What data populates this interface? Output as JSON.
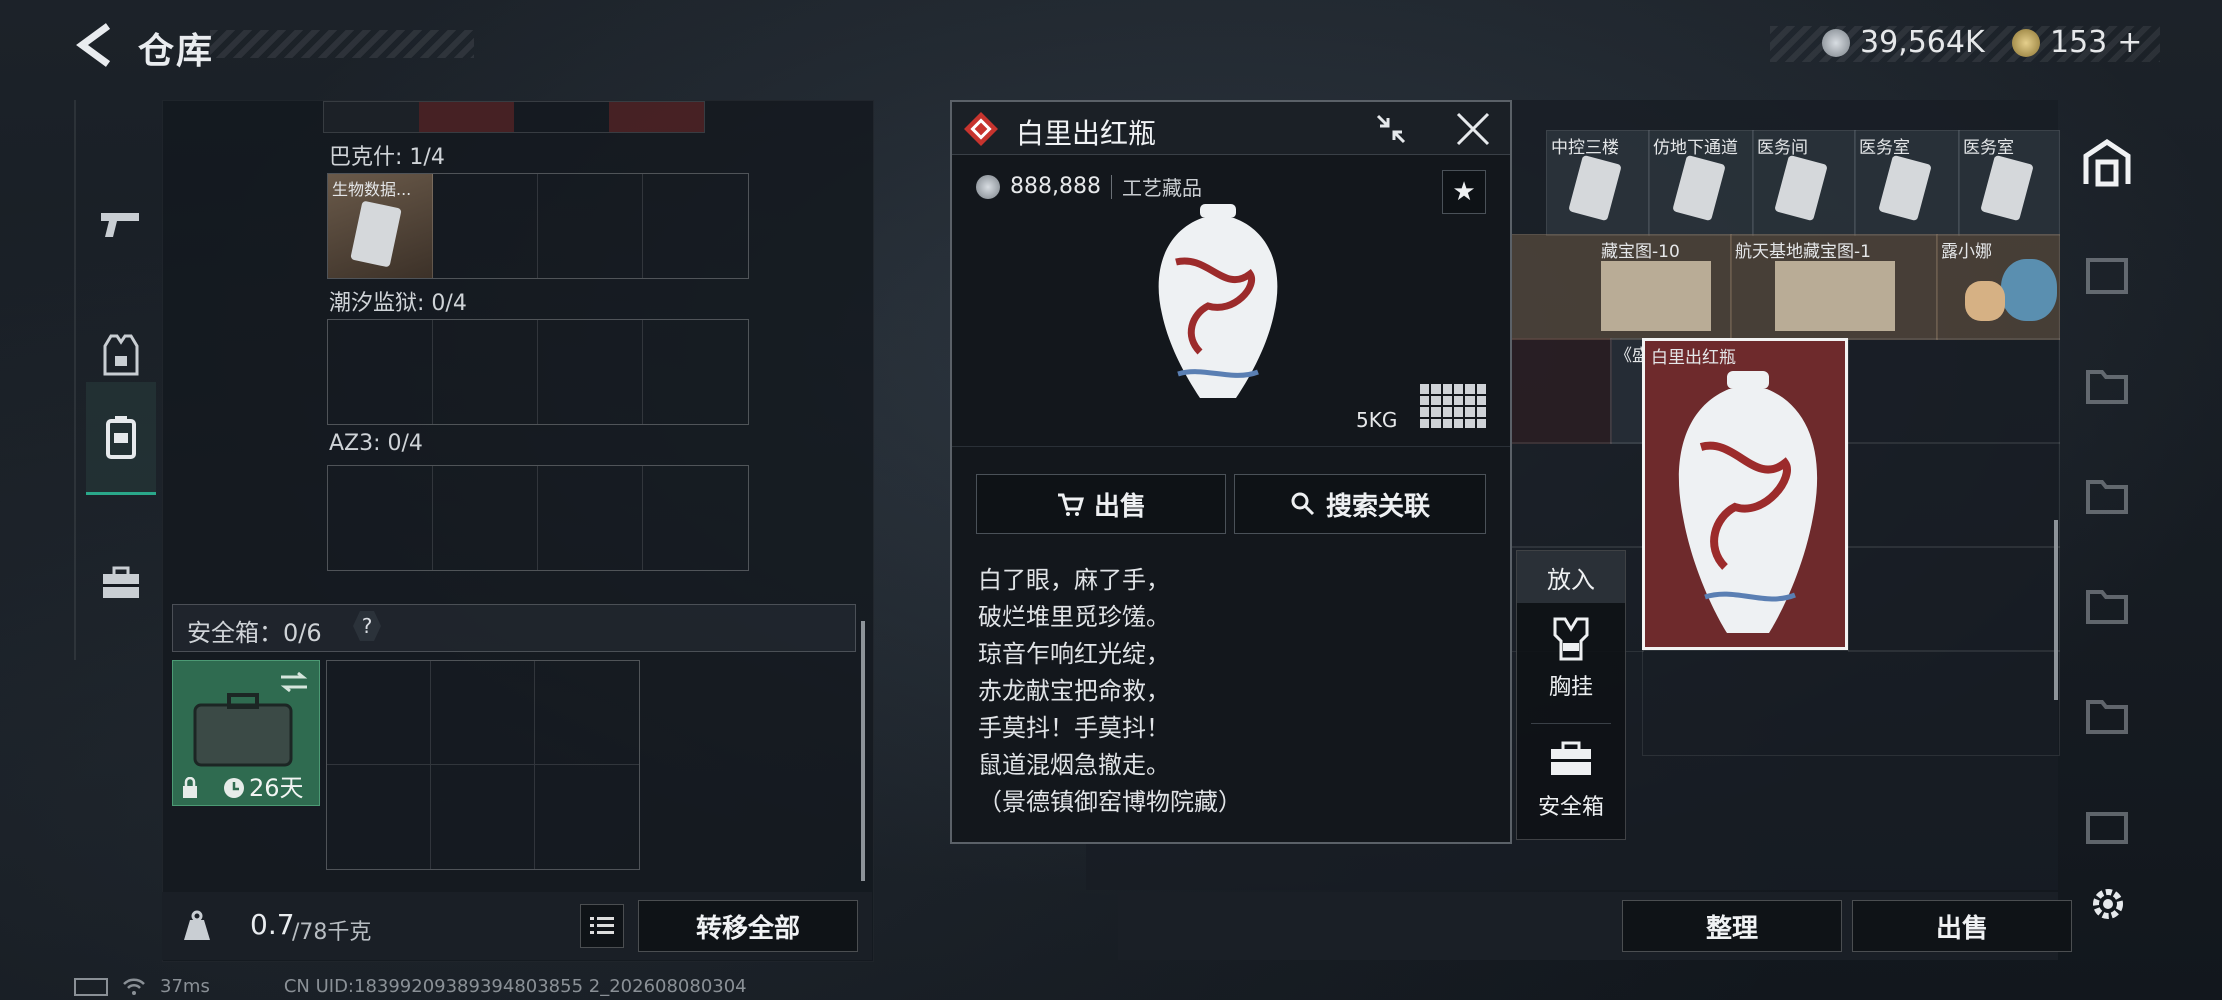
{
  "header": {
    "title": "仓库"
  },
  "currency": {
    "coins": "39,564K",
    "tokens": "153",
    "plus": "+"
  },
  "left_panel": {
    "sections": [
      {
        "label": "巴克什: 1/4",
        "items": [
          {
            "name": "生物数据..."
          }
        ]
      },
      {
        "label": "潮汐监狱: 0/4",
        "items": []
      },
      {
        "label": "AZ3: 0/4",
        "items": []
      }
    ],
    "safe_box": {
      "label": "安全箱：0/6",
      "help": "?",
      "days": "26天"
    },
    "weight": {
      "current": "0.7",
      "max": "/78千克"
    },
    "transfer_all": "转移全部"
  },
  "grid_items": {
    "row1": [
      "中控三楼",
      "仿地下通道",
      "医务间",
      "医务室",
      "医务室"
    ],
    "row2": [
      "藏宝图-10",
      "航天基地藏宝图-1",
      "露小娜"
    ],
    "row3": [
      "《盛世天...",
      "白里出红瓶"
    ]
  },
  "item_detail": {
    "name": "白里出红瓶",
    "price": "888,888",
    "category": "工艺藏品",
    "weight": "5KG",
    "sell": "出售",
    "search_related": "搜索关联",
    "poem": [
      "白了眼，麻了手，",
      "破烂堆里觅珍馐。",
      "琼音乍响红光绽，",
      "赤龙献宝把命救，",
      "手莫抖！手莫抖！",
      "鼠道混烟急撤走。",
      "（景德镇御窑博物院藏）"
    ]
  },
  "put_into": {
    "title": "放入",
    "chest_rig": "胸挂",
    "safe_box": "安全箱"
  },
  "bottom_actions": {
    "organize": "整理",
    "sell": "出售"
  },
  "status_bar": {
    "ping": "37ms",
    "uid": "CN UID:18399209389394803855 2_202608080304"
  },
  "colors": {
    "accent_red": "#c7342e",
    "accent_green": "#2aa88a",
    "selected_cell": "#6e2a2c"
  }
}
